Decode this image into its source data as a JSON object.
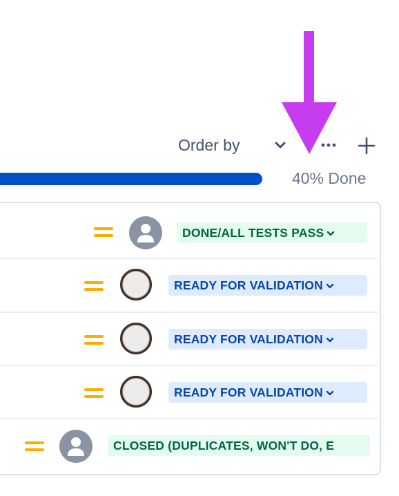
{
  "header": {
    "order_by_label": "Order by",
    "chevron_icon": "chevron-down-icon",
    "more_icon": "more-horizontal-icon",
    "add_icon": "plus-icon"
  },
  "annotation": {
    "arrow_color": "#c63df0",
    "arrow_icon": "arrow-down-icon"
  },
  "progress": {
    "done_fraction": 0.4,
    "label": "40% Done",
    "fill_color": "#0052cc",
    "track_color": "#dfe1e6"
  },
  "issues": [
    {
      "priority": "medium",
      "assignee": "unassigned",
      "status": "DONE/ALL TESTS PASS",
      "status_color": "green"
    },
    {
      "priority": "medium",
      "assignee": "user",
      "status": "READY FOR VALIDATION",
      "status_color": "blue"
    },
    {
      "priority": "medium",
      "assignee": "user",
      "status": "READY FOR VALIDATION",
      "status_color": "blue"
    },
    {
      "priority": "medium",
      "assignee": "user",
      "status": "READY FOR VALIDATION",
      "status_color": "blue"
    },
    {
      "priority": "medium",
      "assignee": "unassigned",
      "status": "CLOSED (DUPLICATES, WON'T DO, E",
      "status_color": "green"
    }
  ],
  "colors": {
    "priority_medium": "#ffab00",
    "status_green_bg": "#e3fcef",
    "status_green_text": "#006644",
    "status_blue_bg": "#deebff",
    "status_blue_text": "#0747a6"
  }
}
